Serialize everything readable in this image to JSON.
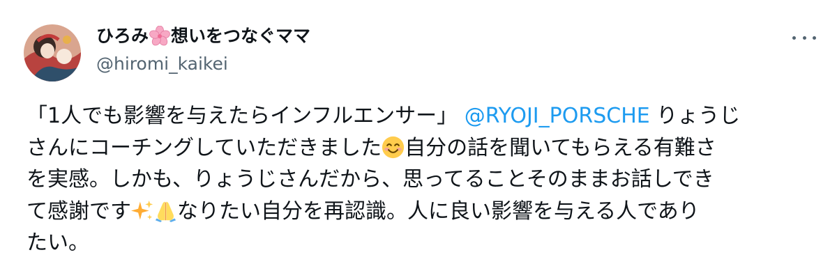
{
  "user": {
    "name_part1": "ひろみ",
    "name_part2": "想いをつなぐママ",
    "name_emoji": "cherry-blossom-icon",
    "handle": "@hiromi_kaikei",
    "avatar": "avatar-image"
  },
  "menu": {
    "more_icon": "more-dots-icon"
  },
  "tweet": {
    "line1_text": "「1人でも影響を与えたらインフルエンサー」",
    "mention": "@RYOJI_PORSCHE",
    "line1_end": " りょうじ",
    "line2_a": "さんにコーチングしていただきました",
    "line2_emoji": "smiling-face-icon",
    "line2_b": "自分の話を聞いてもらえる有難さ",
    "line3": "を実感。しかも、りょうじさんだから、思ってることそのままお話しでき",
    "line4_a": "て感謝です",
    "line4_emoji1": "sparkles-icon",
    "line4_emoji2": "folded-hands-icon",
    "line4_b": "なりたい自分を再認識。人に良い影響を与える人であり",
    "line5": "たい。"
  },
  "colors": {
    "text": "#0f1419",
    "secondary": "#536471",
    "link": "#1d9bf0"
  }
}
